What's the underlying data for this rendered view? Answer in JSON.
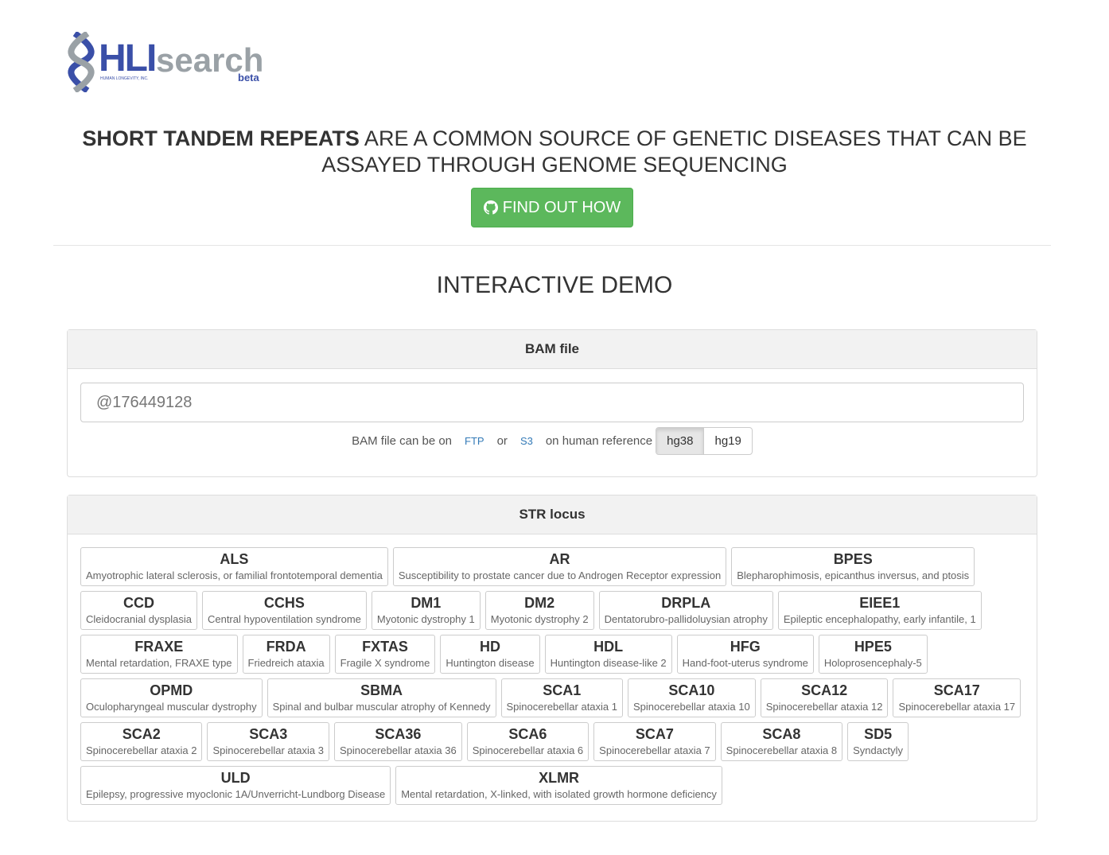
{
  "logo": {
    "main": "HLI",
    "sub": "search",
    "tag": "beta",
    "company": "HUMAN LONGEVITY, INC."
  },
  "headline": {
    "bold": "SHORT TANDEM REPEATS",
    "rest": " ARE A COMMON SOURCE OF GENETIC DISEASES THAT CAN BE ASSAYED THROUGH GENOME SEQUENCING"
  },
  "cta": {
    "label": "FIND OUT HOW",
    "icon": "github-icon"
  },
  "demo_title": "INTERACTIVE DEMO",
  "bam": {
    "title": "BAM file",
    "value": "@176449128",
    "hint_prefix": "BAM file can be on",
    "ftp": "FTP",
    "or": "or",
    "s3": "S3",
    "hint_suffix": "on human reference",
    "refs": [
      "hg38",
      "hg19"
    ],
    "selected": "hg38"
  },
  "str": {
    "title": "STR locus",
    "loci": [
      {
        "n": "ALS",
        "d": "Amyotrophic lateral sclerosis, or familial frontotemporal dementia"
      },
      {
        "n": "AR",
        "d": "Susceptibility to prostate cancer due to Androgen Receptor expression"
      },
      {
        "n": "BPES",
        "d": "Blepharophimosis, epicanthus inversus, and ptosis"
      },
      {
        "n": "CCD",
        "d": "Cleidocranial dysplasia"
      },
      {
        "n": "CCHS",
        "d": "Central hypoventilation syndrome"
      },
      {
        "n": "DM1",
        "d": "Myotonic dystrophy 1"
      },
      {
        "n": "DM2",
        "d": "Myotonic dystrophy 2"
      },
      {
        "n": "DRPLA",
        "d": "Dentatorubro-pallidoluysian atrophy"
      },
      {
        "n": "EIEE1",
        "d": "Epileptic encephalopathy, early infantile, 1"
      },
      {
        "n": "FRAXE",
        "d": "Mental retardation, FRAXE type"
      },
      {
        "n": "FRDA",
        "d": "Friedreich ataxia"
      },
      {
        "n": "FXTAS",
        "d": "Fragile X syndrome"
      },
      {
        "n": "HD",
        "d": "Huntington disease"
      },
      {
        "n": "HDL",
        "d": "Huntington disease-like 2"
      },
      {
        "n": "HFG",
        "d": "Hand-foot-uterus syndrome"
      },
      {
        "n": "HPE5",
        "d": "Holoprosencephaly-5"
      },
      {
        "n": "OPMD",
        "d": "Oculopharyngeal muscular dystrophy"
      },
      {
        "n": "SBMA",
        "d": "Spinal and bulbar muscular atrophy of Kennedy"
      },
      {
        "n": "SCA1",
        "d": "Spinocerebellar ataxia 1"
      },
      {
        "n": "SCA10",
        "d": "Spinocerebellar ataxia 10"
      },
      {
        "n": "SCA12",
        "d": "Spinocerebellar ataxia 12"
      },
      {
        "n": "SCA17",
        "d": "Spinocerebellar ataxia 17"
      },
      {
        "n": "SCA2",
        "d": "Spinocerebellar ataxia 2"
      },
      {
        "n": "SCA3",
        "d": "Spinocerebellar ataxia 3"
      },
      {
        "n": "SCA36",
        "d": "Spinocerebellar ataxia 36"
      },
      {
        "n": "SCA6",
        "d": "Spinocerebellar ataxia 6"
      },
      {
        "n": "SCA7",
        "d": "Spinocerebellar ataxia 7"
      },
      {
        "n": "SCA8",
        "d": "Spinocerebellar ataxia 8"
      },
      {
        "n": "SD5",
        "d": "Syndactyly"
      },
      {
        "n": "ULD",
        "d": "Epilepsy, progressive myoclonic 1A/Unverricht-Lundborg Disease"
      },
      {
        "n": "XLMR",
        "d": "Mental retardation, X-linked, with isolated growth hormone deficiency"
      }
    ]
  }
}
